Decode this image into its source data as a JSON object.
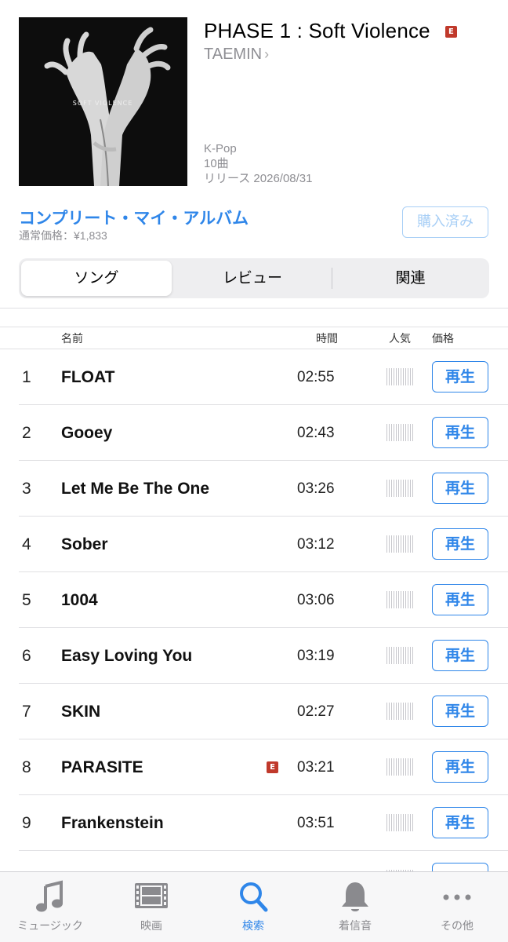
{
  "album": {
    "title": "PHASE 1 : Soft Violence",
    "explicit_badge": "E",
    "artist": "TAEMIN",
    "genre": "K-Pop",
    "track_count": "10曲",
    "release": "リリース 2026/08/31",
    "artwork_text": "SOFT VIOLENCE"
  },
  "complete_album": {
    "title": "コンプリート・マイ・アルバム",
    "regular_price": "通常価格：¥1,833",
    "purchased_label": "購入済み"
  },
  "segments": [
    "ソング",
    "レビュー",
    "関連"
  ],
  "columns": {
    "name": "名前",
    "time": "時間",
    "popularity": "人気",
    "price": "価格"
  },
  "colors": {
    "accent": "#2f86e9",
    "explicit": "#c0392b"
  },
  "songs": [
    {
      "num": "1",
      "title": "FLOAT",
      "time": "02:55",
      "explicit": "",
      "action": "再生"
    },
    {
      "num": "2",
      "title": "Gooey",
      "time": "02:43",
      "explicit": "",
      "action": "再生"
    },
    {
      "num": "3",
      "title": "Let Me Be The One",
      "time": "03:26",
      "explicit": "",
      "action": "再生"
    },
    {
      "num": "4",
      "title": "Sober",
      "time": "03:12",
      "explicit": "",
      "action": "再生"
    },
    {
      "num": "5",
      "title": "1004",
      "time": "03:06",
      "explicit": "",
      "action": "再生"
    },
    {
      "num": "6",
      "title": "Easy Loving You",
      "time": "03:19",
      "explicit": "",
      "action": "再生"
    },
    {
      "num": "7",
      "title": "SKIN",
      "time": "02:27",
      "explicit": "",
      "action": "再生"
    },
    {
      "num": "8",
      "title": "PARASITE",
      "time": "03:21",
      "explicit": "E",
      "action": "再生"
    },
    {
      "num": "9",
      "title": "Frankenstein",
      "time": "03:51",
      "explicit": "",
      "action": "再生"
    }
  ],
  "tabbar": [
    {
      "label": "ミュージック",
      "icon": "music-note-icon",
      "active": false
    },
    {
      "label": "映画",
      "icon": "film-icon",
      "active": false
    },
    {
      "label": "検索",
      "icon": "search-icon",
      "active": true
    },
    {
      "label": "着信音",
      "icon": "bell-icon",
      "active": false
    },
    {
      "label": "その他",
      "icon": "more-icon",
      "active": false
    }
  ]
}
